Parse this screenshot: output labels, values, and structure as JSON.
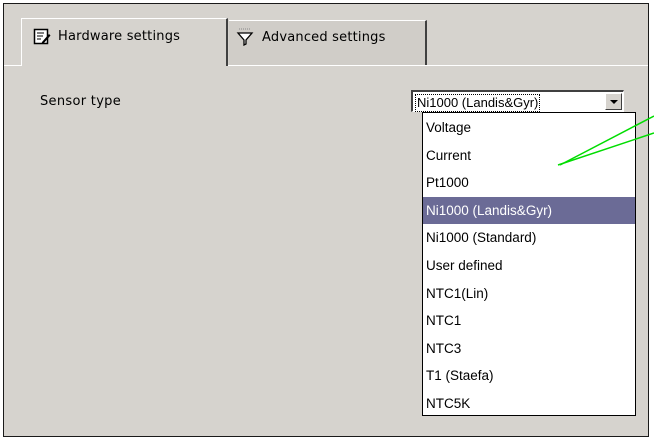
{
  "tabs": [
    {
      "label": "Hardware settings",
      "icon": "notepad-edit-icon",
      "active": true
    },
    {
      "label": "Advanced settings",
      "icon": "funnel-filter-icon",
      "active": false
    }
  ],
  "form": {
    "sensor_type_label": "Sensor type",
    "sensor_type_value": "Ni1000 (Landis&Gyr)"
  },
  "dropdown": {
    "options": [
      "Voltage",
      "Current",
      "Pt1000",
      "Ni1000 (Landis&Gyr)",
      "Ni1000 (Standard)",
      "User defined",
      "NTC1(Lin)",
      "NTC1",
      "NTC3",
      "T1 (Staefa)",
      "NTC5K"
    ],
    "selected": "Ni1000 (Landis&Gyr)"
  },
  "colors": {
    "panel_bg": "#d6d3ce",
    "selection_bg": "#6b6b96",
    "callout_line": "#00dd00"
  }
}
